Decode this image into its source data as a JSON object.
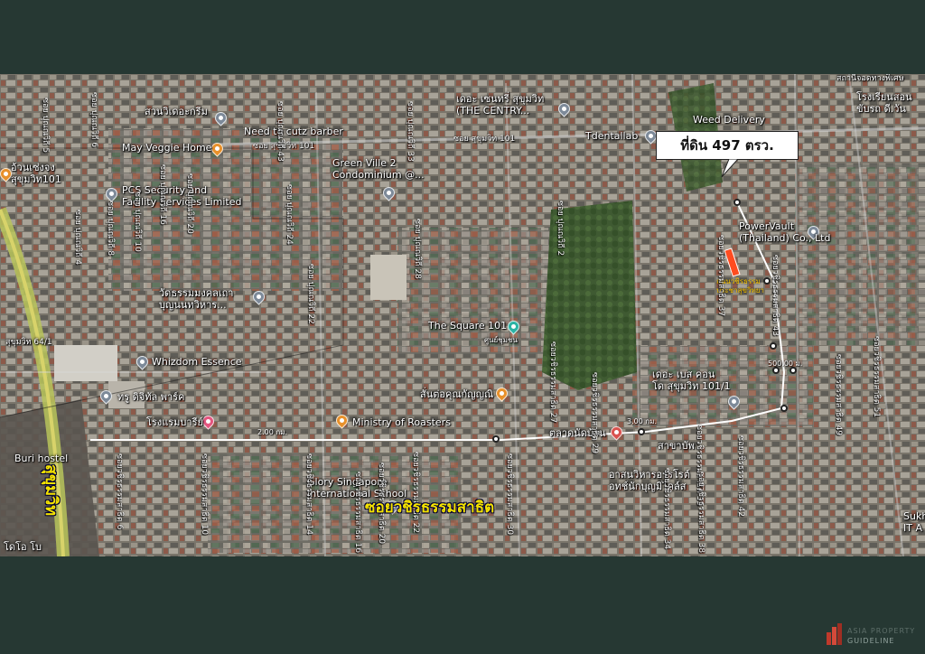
{
  "callout": {
    "text": "ที่ดิน 497 ตรว."
  },
  "road_title": "ซอยวชิรธรรมสาธิต",
  "main_road": "สุขุมวิท",
  "site_label": [
    "ถนนวชิรธรรม",
    "ประชาสุขวิทยา"
  ],
  "distances": {
    "d1": "2.00 กม.",
    "d2": "3.00 กม.",
    "d3": "500.00 ม."
  },
  "pois": [
    {
      "id": "weed-delivery",
      "label": "Weed Delivery",
      "pin": "none"
    },
    {
      "id": "tdentallab",
      "label": "Tdentallab",
      "pin": "gray"
    },
    {
      "id": "powervault",
      "label": "PowerVault\n(Thailand) Co., Ltd",
      "pin": "gray"
    },
    {
      "id": "the-centry",
      "label": "เดอะ เซนทรี่ สุขุมวิท\n(THE CENTRY...",
      "pin": "gray"
    },
    {
      "id": "need-to-cutz",
      "label": "Need to cutz barber",
      "pin": "gray"
    },
    {
      "id": "may-veggie",
      "label": "May Veggie Home",
      "pin": "orange"
    },
    {
      "id": "pcs-security",
      "label": "PCS Security and\nFacility Services Limited",
      "pin": "gray"
    },
    {
      "id": "green-ville",
      "label": "Green Ville 2\nCondominium @...",
      "pin": "gray"
    },
    {
      "id": "the-square",
      "label": "The Square 101",
      "pin": "teal"
    },
    {
      "id": "the-square-th",
      "label": "ศูนย์ชุมชน",
      "pin": "none"
    },
    {
      "id": "wat-dhamma",
      "label": "วัดธรรมมงคลเถา\nบุญนนทวิหาร...",
      "pin": "gray"
    },
    {
      "id": "whizdom",
      "label": "Whizdom Essence",
      "pin": "gray"
    },
    {
      "id": "true-digital",
      "label": "ทรู ดิจิทัล พาร์ค",
      "pin": "gray"
    },
    {
      "id": "hotel",
      "label": "โรงแรมบารีย์",
      "pin": "pink"
    },
    {
      "id": "ministry-roasters",
      "label": "Ministry of Roasters",
      "pin": "orange"
    },
    {
      "id": "sam-pun",
      "label": "สั่นต่อคุณกัญญณิ",
      "pin": "orange"
    },
    {
      "id": "market",
      "label": "ตลาดนัดบ้าน",
      "pin": "red"
    },
    {
      "id": "the-base",
      "label": "เดอะ เบส คอน\nโด สุขุมวิท 101/1",
      "pin": "gray"
    },
    {
      "id": "buri-hostel",
      "label": "Buri hostel",
      "pin": "none"
    },
    {
      "id": "glory-singapore",
      "label": "Glory Singapore\nInternational School",
      "pin": "gray"
    },
    {
      "id": "church",
      "label": "อาสนวิหารอรรโรต์\nอทช์นักบุญมิไคล์ส",
      "pin": "none"
    },
    {
      "id": "sathorn",
      "label": "สาขาบัพ",
      "pin": "none"
    },
    {
      "id": "school-top-right",
      "label": "โรงเรียนสอน\nขับรถ ดี.วัน",
      "pin": "none"
    },
    {
      "id": "top-right-label",
      "label": "สถานีจอดทางพิเศษ",
      "pin": "none"
    },
    {
      "id": "left-top",
      "label": "อ้วนเซ่งจง\nสุขุมวิท101",
      "pin": "orange"
    },
    {
      "id": "left-sukhumvit",
      "label": "สุขุมวิท 64/1",
      "pin": "none"
    },
    {
      "id": "left-bottom",
      "label": "โดโอ โบ",
      "pin": "none"
    },
    {
      "id": "sukh-right",
      "label": "Sukh\nIT A",
      "pin": "none"
    },
    {
      "id": "kondo-green",
      "label": "สวนวิเดอะกรีม",
      "pin": "none"
    }
  ],
  "streets": [
    "ซอย สุขุมวิท 101",
    "ซอย ปุณณวิถี 43",
    "ซอย ปุณณวิถี 24",
    "ซอย ปุณณวิถี 28",
    "ซอย ปุณณวิถี 33",
    "ซอย ปุณณวิถี 2",
    "ซอย ปุณณวิถี 22",
    "ซอยวชิรธรรมสาธิต 37",
    "ซอยวชิรธรรมสาธิต 43",
    "ซอยวชิรธรรมสาธิต 29",
    "ซอยวชิรธรรมสาธิต 27",
    "ซอยวชิรธรรมสาธิต 51",
    "ซอยวชิรธรรมสาธิต 49",
    "ซอยวชิรธรรมสาธิต 35",
    "ซอยวชิรธรรมสาธิต 42",
    "ซอยวชิรธรรมสาธิต 34",
    "ซอยวชิรธรรมสาธิต 38",
    "ซอยวชิรธรรมสาธิต 30",
    "ซอยวชิรธรรมสาธิต 22",
    "ซอยวชิรธรรมสาธิต 20",
    "ซอยวชิรธรรมสาธิต 16",
    "ซอยวชิรธรรมสาธิต 14",
    "ซอยวชิรธรรมสาธิต 10",
    "ซอยวชิรธรรมสาธิต 6",
    "ซอย ปุณณวิถี 20",
    "ซอย ปุณณวิถี 16",
    "ซอย ปุณณวิถี 10",
    "ซอย ปุณณวิถี 8",
    "ซอย ปุณณวิถี 4",
    "ซอย ปุณณวิถี 6",
    "ซอย ปุณณวิถี 5"
  ],
  "watermark": {
    "line1": "ASIA PROPERTY",
    "line2": "GUIDELINE"
  },
  "colors": {
    "frame": "#263833",
    "road_title": "#f5e300",
    "plot": "#ff4b1f"
  }
}
